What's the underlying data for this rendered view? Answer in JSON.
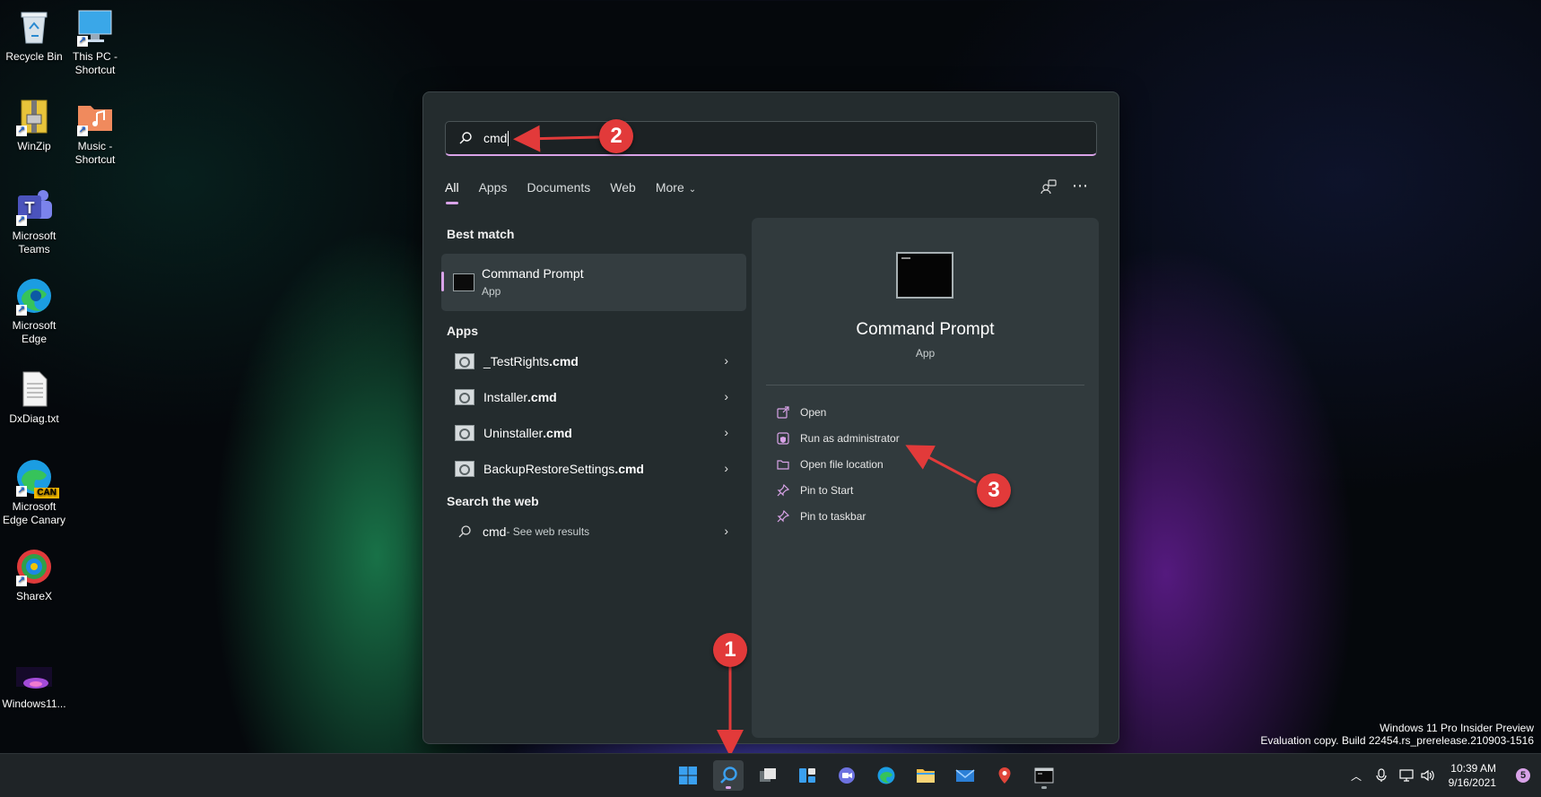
{
  "desktop": {
    "icons": [
      {
        "label": "Recycle Bin"
      },
      {
        "label": "This PC - Shortcut"
      },
      {
        "label": "WinZip"
      },
      {
        "label": "Music - Shortcut"
      },
      {
        "label": "Microsoft Teams"
      },
      {
        "label": "Microsoft Edge"
      },
      {
        "label": "DxDiag.txt"
      },
      {
        "label": "Microsoft Edge Canary"
      },
      {
        "label": "ShareX"
      },
      {
        "label": "Windows11..."
      }
    ],
    "canary_badge": "CAN",
    "watermark": {
      "line1": "Windows 11 Pro Insider Preview",
      "line2": "Evaluation copy. Build 22454.rs_prerelease.210903-1516"
    }
  },
  "search": {
    "query": "cmd",
    "tabs": [
      "All",
      "Apps",
      "Documents",
      "Web",
      "More"
    ],
    "active_tab": "All",
    "tool_icons": [
      "share-account-icon",
      "more-options-icon"
    ]
  },
  "results": {
    "best_match_title": "Best match",
    "best_match": {
      "name": "Command Prompt",
      "type": "App"
    },
    "apps_title": "Apps",
    "apps": [
      {
        "prefix": "_TestRights",
        "ext": ".cmd"
      },
      {
        "prefix": "Installer",
        "ext": ".cmd"
      },
      {
        "prefix": "Uninstaller",
        "ext": ".cmd"
      },
      {
        "prefix": "BackupRestoreSettings",
        "ext": ".cmd"
      }
    ],
    "web_title": "Search the web",
    "web": {
      "query": "cmd",
      "suffix": " - See web results"
    }
  },
  "detail": {
    "name": "Command Prompt",
    "type": "App",
    "actions": [
      "Open",
      "Run as administrator",
      "Open file location",
      "Pin to Start",
      "Pin to taskbar"
    ]
  },
  "annotations": {
    "step1": "1",
    "step2": "2",
    "step3": "3",
    "color": "#e23a3a"
  },
  "taskbar": {
    "icons": [
      "windows-start-icon",
      "search-icon",
      "task-view-icon",
      "widgets-icon",
      "chat-icon",
      "edge-icon",
      "file-explorer-icon",
      "mail-icon",
      "maps-icon",
      "command-prompt-icon"
    ],
    "time": "10:39 AM",
    "date": "9/16/2021",
    "notification_count": "5"
  },
  "colors": {
    "accent": "#d9a3e8",
    "panel": "#242c2e",
    "taskbar": "#1f2427"
  }
}
